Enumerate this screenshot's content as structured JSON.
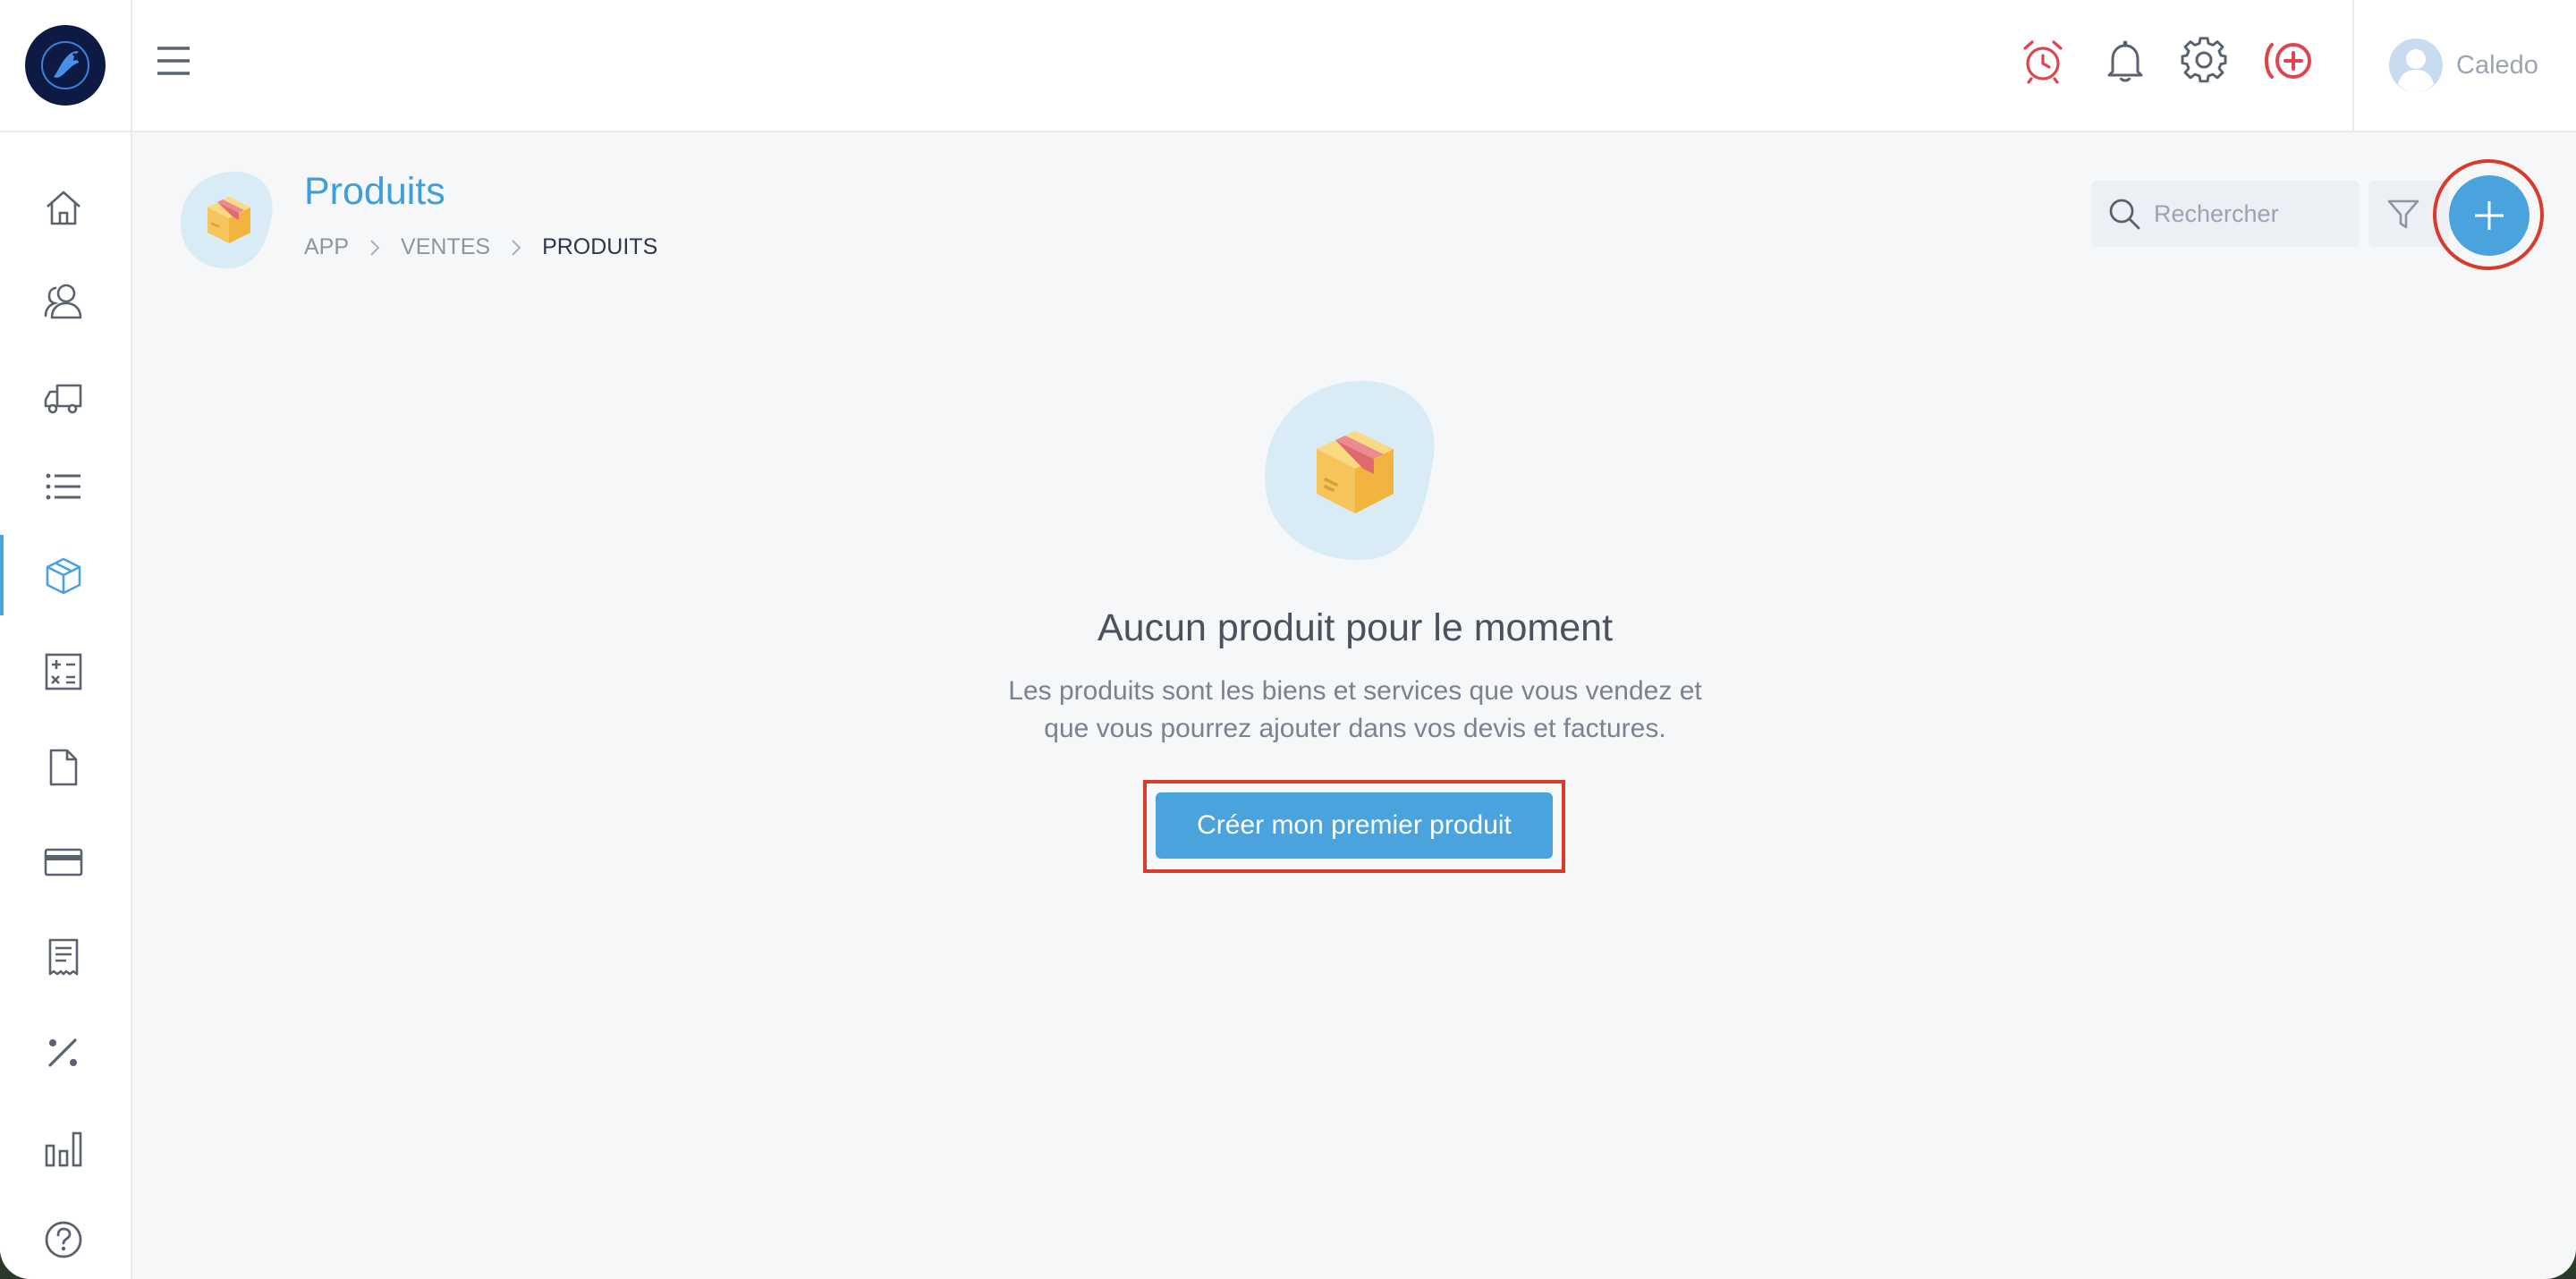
{
  "app": {
    "accent": "#4aa3dd",
    "highlight": "#d93a2b"
  },
  "topbar": {
    "menu_icon": "hamburger-icon",
    "icons": [
      "alarm-clock-icon",
      "bell-icon",
      "gear-icon",
      "add-circle-icon"
    ],
    "user": {
      "name": "Caledo",
      "avatar_icon": "user-avatar-icon"
    }
  },
  "sidebar": {
    "items": [
      {
        "icon": "home-icon"
      },
      {
        "icon": "users-icon"
      },
      {
        "icon": "truck-icon"
      },
      {
        "icon": "list-icon"
      },
      {
        "icon": "cube-icon",
        "active": true
      },
      {
        "icon": "calculator-icon"
      },
      {
        "icon": "document-icon"
      },
      {
        "icon": "credit-card-icon"
      },
      {
        "icon": "receipt-icon"
      },
      {
        "icon": "percent-icon"
      },
      {
        "icon": "bar-chart-icon"
      },
      {
        "icon": "help-icon"
      }
    ]
  },
  "header": {
    "title": "Produits",
    "breadcrumb": [
      "APP",
      "VENTES",
      "PRODUITS"
    ]
  },
  "search": {
    "placeholder": "Rechercher"
  },
  "empty_state": {
    "title": "Aucun produit pour le moment",
    "description_line1": "Les produits sont les biens et services que vous vendez et",
    "description_line2": "que vous pourrez ajouter dans vos devis et factures.",
    "cta_label": "Créer mon premier produit"
  }
}
